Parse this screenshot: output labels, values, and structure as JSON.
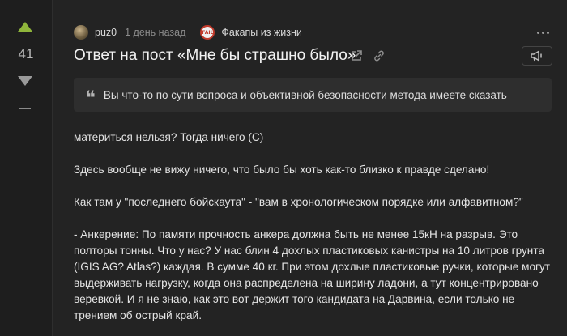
{
  "rating": {
    "count": "41"
  },
  "meta": {
    "username": "puz0",
    "time": "1 день назад",
    "community": "Факапы из жизни"
  },
  "post": {
    "title": "Ответ на пост «Мне бы страшно было»"
  },
  "quote": {
    "text": "Вы что-то по сути вопроса и объективной безопасности метода имеете сказать"
  },
  "body": {
    "paragraphs": [
      "материться нельзя? Тогда ничего (С)",
      "Здесь вообще не вижу ничего, что было бы хоть как-то близко к правде сделано!",
      "Как там у \"последнего бойскаута\" - \"вам в хронологическом порядке или алфавитном?\"",
      "- Анкерение: По памяти прочность анкера должна быть не менее 15кН на разрыв. Это полторы тонны. Что у нас? У нас блин 4 дохлых пластиковых канистры на 10 литров грунта (IGIS AG? Atlas?) каждая. В сумме 40 кг. При этом дохлые пластиковые ручки, которые могут выдерживать нагрузку, когда она распределена на ширину ладони, а тут концентрировано веревкой. И я не знаю, как это вот держит того кандидата на Дарвина, если только не трением об острый край."
    ]
  },
  "colors": {
    "upvote": "#8fb53b",
    "background": "#232323",
    "community_badge": "#c23a2b"
  },
  "icons": [
    "arrow-up-icon",
    "arrow-down-icon",
    "more-icon",
    "external-link-icon",
    "link-icon",
    "megaphone-icon",
    "quote-icon"
  ]
}
